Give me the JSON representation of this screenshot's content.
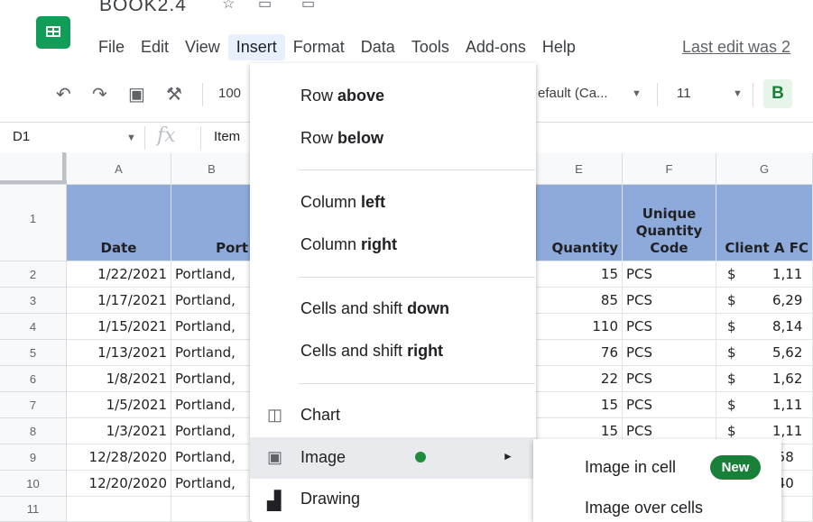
{
  "app": {
    "doc_title": "BOOK2.4",
    "last_edit": "Last edit was 2",
    "menu": [
      "File",
      "Edit",
      "View",
      "Insert",
      "Format",
      "Data",
      "Tools",
      "Add-ons",
      "Help"
    ],
    "active_menu": "Insert"
  },
  "toolbar": {
    "zoom": "100",
    "font": "efault (Ca...",
    "font_size": "11",
    "bold": "B"
  },
  "formula_bar": {
    "cell_ref": "D1",
    "fx": "fx",
    "content": "Item"
  },
  "columns": [
    "A",
    "B",
    "E",
    "F",
    "G"
  ],
  "row_numbers": [
    "1",
    "2",
    "3",
    "4",
    "5",
    "6",
    "7",
    "8",
    "9",
    "10",
    "11"
  ],
  "header_row": {
    "A": "Date",
    "B": "Port",
    "E": "Quantity",
    "F": [
      "Unique",
      "Quantity",
      "Code"
    ],
    "G": "Client A FC"
  },
  "rows": [
    {
      "A": "1/22/2021",
      "B": "Portland,",
      "E": "15",
      "F": "PCS",
      "G_cur": "$",
      "G": "1,11"
    },
    {
      "A": "1/17/2021",
      "B": "Portland,",
      "E": "85",
      "F": "PCS",
      "G_cur": "$",
      "G": "6,29"
    },
    {
      "A": "1/15/2021",
      "B": "Portland,",
      "E": "110",
      "F": "PCS",
      "G_cur": "$",
      "G": "8,14"
    },
    {
      "A": "1/13/2021",
      "B": "Portland,",
      "E": "76",
      "F": "PCS",
      "G_cur": "$",
      "G": "5,62"
    },
    {
      "A": "1/8/2021",
      "B": "Portland,",
      "E": "22",
      "F": "PCS",
      "G_cur": "$",
      "G": "1,62"
    },
    {
      "A": "1/5/2021",
      "B": "Portland,",
      "E": "15",
      "F": "PCS",
      "G_cur": "$",
      "G": "1,11"
    },
    {
      "A": "1/3/2021",
      "B": "Portland,",
      "E": "15",
      "F": "PCS",
      "G_cur": "$",
      "G": "1,11"
    },
    {
      "A": "12/28/2020",
      "B": "Portland,",
      "E": "",
      "F": "",
      "G_cur": "",
      "G": ",58"
    },
    {
      "A": "12/20/2020",
      "B": "Portland,",
      "E": "",
      "F": "",
      "G_cur": "",
      "G": ",40"
    },
    {
      "A": "",
      "B": "",
      "E": "",
      "F": "",
      "G_cur": "",
      "G": ""
    }
  ],
  "insert_menu": {
    "row_above": {
      "prefix": "Row ",
      "bold": "above"
    },
    "row_below": {
      "prefix": "Row ",
      "bold": "below"
    },
    "column_left": {
      "prefix": "Column ",
      "bold": "left"
    },
    "column_right": {
      "prefix": "Column ",
      "bold": "right"
    },
    "cells_down": {
      "prefix": "Cells and shift ",
      "bold": "down"
    },
    "cells_right": {
      "prefix": "Cells and shift ",
      "bold": "right"
    },
    "chart": "Chart",
    "image": "Image",
    "drawing": "Drawing"
  },
  "image_submenu": {
    "in_cell": "Image in cell",
    "badge": "New",
    "over_cells": "Image over cells"
  },
  "colors": {
    "header_fill": "#8eaadb",
    "brand_green": "#0f9d58",
    "badge_green": "#188038"
  }
}
